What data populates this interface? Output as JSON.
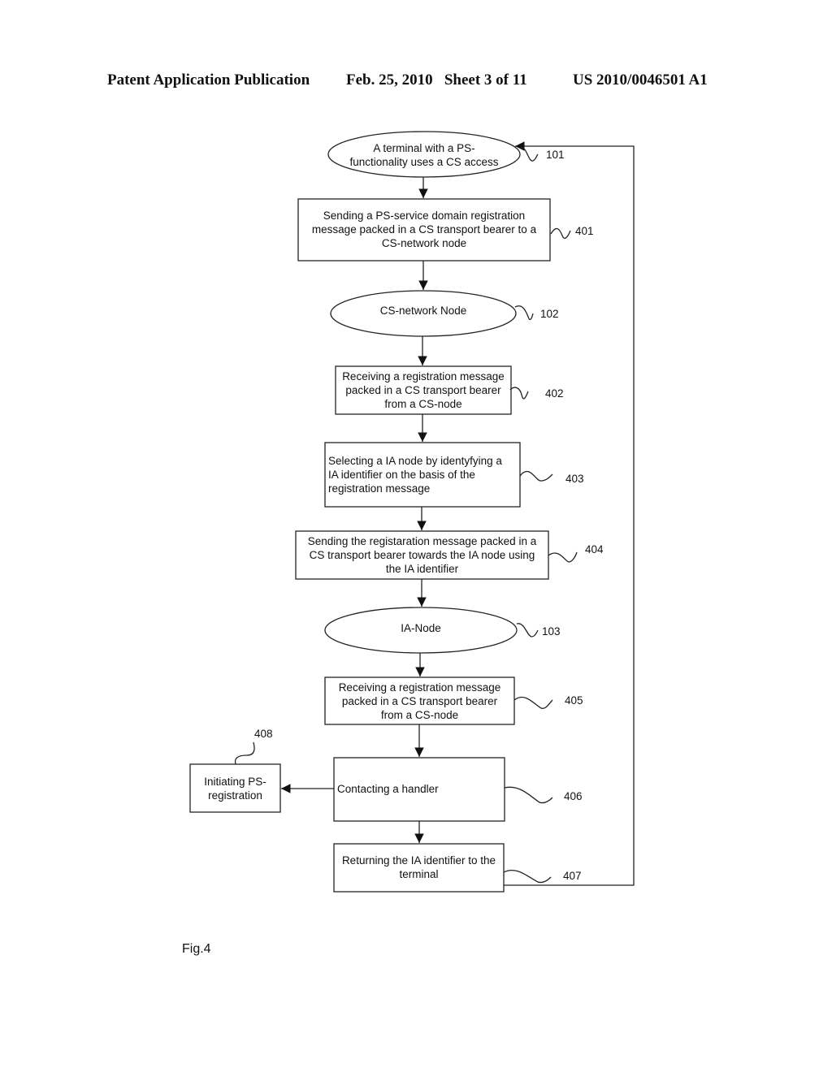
{
  "header": {
    "publication": "Patent Application Publication",
    "date_sheet": "Feb. 25, 2010   Sheet 3 of 11",
    "patent_number": "US 2010/0046501 A1"
  },
  "figure_label": "Fig.4",
  "nodes": {
    "n101": {
      "type": "ellipse",
      "text": "A terminal with a PS-\nfunctionality uses a CS access",
      "ref": "101"
    },
    "n401": {
      "type": "box",
      "text": "Sending a PS-service domain registration\nmessage packed in a CS transport bearer to a\nCS-network node",
      "ref": "401"
    },
    "n102": {
      "type": "ellipse",
      "text": "CS-network Node",
      "ref": "102"
    },
    "n402": {
      "type": "box",
      "text": "Receiving a registration message\npacked in a CS transport bearer\nfrom a CS-node",
      "ref": "402"
    },
    "n403": {
      "type": "box",
      "text": "Selecting a IA node by identyfying a\nIA identifier on the basis of the\nregistration message",
      "ref": "403"
    },
    "n404": {
      "type": "box",
      "text": "Sending the registaration message packed in a\nCS transport bearer towards the IA node using\nthe IA identifier",
      "ref": "404"
    },
    "n103": {
      "type": "ellipse",
      "text": "IA-Node",
      "ref": "103"
    },
    "n405": {
      "type": "box",
      "text": "Receiving a registration message\npacked in a CS transport bearer\nfrom a CS-node",
      "ref": "405"
    },
    "n406": {
      "type": "box",
      "text": "Contacting a handler",
      "ref": "406"
    },
    "n407": {
      "type": "box",
      "text": "Returning the IA identifier to the\nterminal",
      "ref": "407"
    },
    "n408": {
      "type": "box",
      "text": "Initiating PS-\nregistration",
      "ref": "408"
    }
  },
  "edges": [
    {
      "from": "101",
      "to": "401"
    },
    {
      "from": "401",
      "to": "102"
    },
    {
      "from": "102",
      "to": "402"
    },
    {
      "from": "402",
      "to": "403"
    },
    {
      "from": "403",
      "to": "404"
    },
    {
      "from": "404",
      "to": "103"
    },
    {
      "from": "103",
      "to": "405"
    },
    {
      "from": "405",
      "to": "406"
    },
    {
      "from": "406",
      "to": "408"
    },
    {
      "from": "406",
      "to": "407"
    },
    {
      "from": "407",
      "to": "101"
    }
  ]
}
